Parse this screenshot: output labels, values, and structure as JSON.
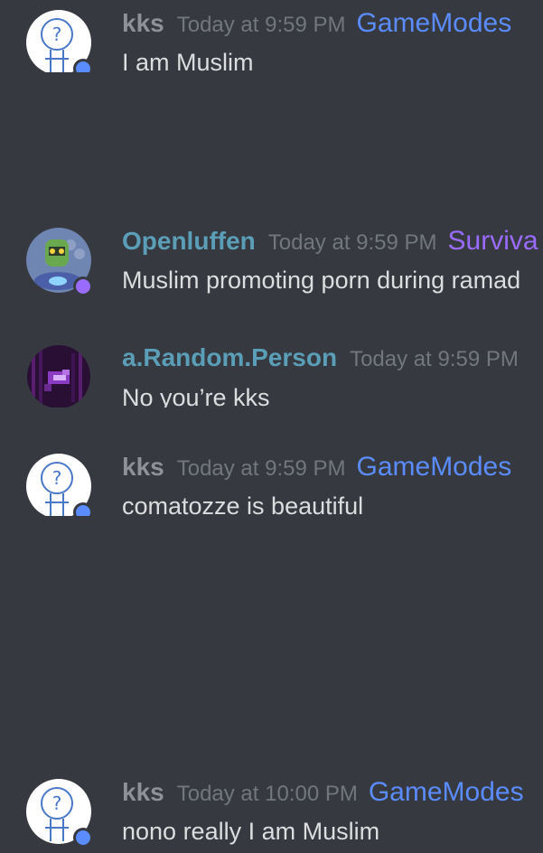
{
  "colors": {
    "background": "#36393f",
    "text": "#dcddde",
    "timestamp": "#72767d",
    "online_dot": "#5b8cff",
    "idle_dot": "#9a6bff"
  },
  "messages": [
    {
      "username": "kks",
      "username_color": "#8e9297",
      "timestamp": "Today at 9:59 PM",
      "tag": "GameModes",
      "tag_color": "#5b8cff",
      "content": "I am Muslim",
      "avatar_icon": "question-stickfigure-avatar",
      "status_color": "#5b8cff"
    },
    {
      "username": "Openluffen",
      "username_color": "#5b9eb8",
      "timestamp": "Today at 9:59 PM",
      "tag": "Surviva",
      "tag_color": "#9a6bff",
      "content": "Muslim promoting porn during ramad",
      "avatar_icon": "robot-avatar",
      "status_color": "#9a6bff"
    },
    {
      "username": "a.Random.Person",
      "username_color": "#5b9eb8",
      "timestamp": "Today at 9:59 PM",
      "tag": "",
      "tag_color": "#5b8cff",
      "content": "No you’re kks",
      "avatar_icon": "pixel-art-avatar",
      "status_color": ""
    },
    {
      "username": "kks",
      "username_color": "#8e9297",
      "timestamp": "Today at 9:59 PM",
      "tag": "GameModes",
      "tag_color": "#5b8cff",
      "content": "comatozze is beautiful",
      "avatar_icon": "question-stickfigure-avatar",
      "status_color": "#5b8cff"
    },
    {
      "username": "kks",
      "username_color": "#8e9297",
      "timestamp": "Today at 10:00 PM",
      "tag": "GameModes",
      "tag_color": "#5b8cff",
      "content": "nono really I am Muslim",
      "avatar_icon": "question-stickfigure-avatar",
      "status_color": "#5b8cff"
    }
  ]
}
